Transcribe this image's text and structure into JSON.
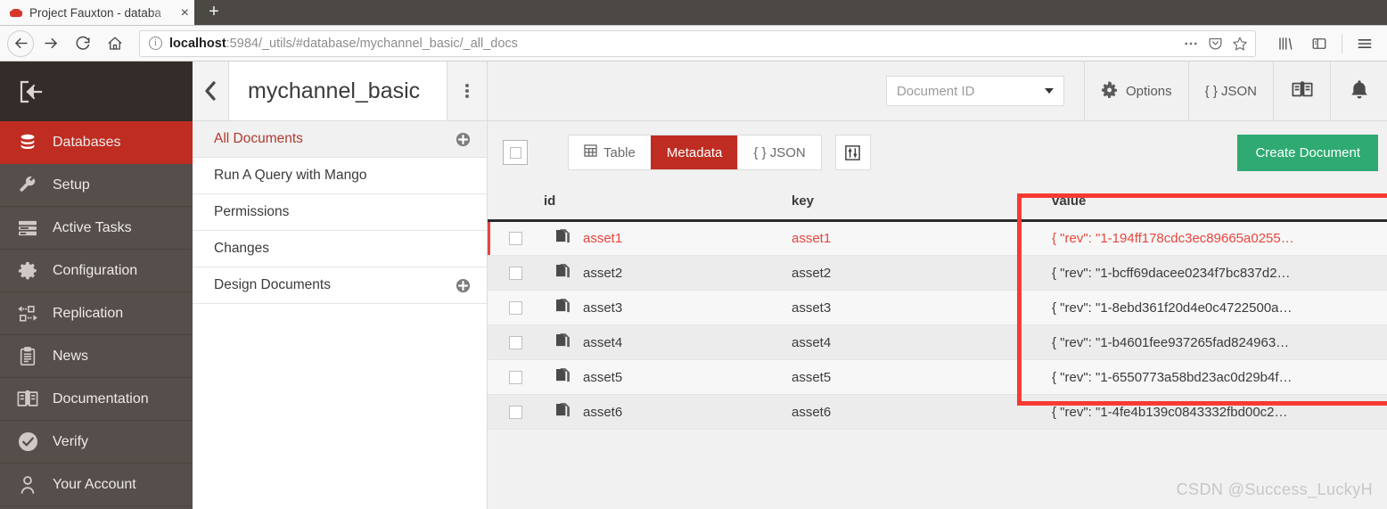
{
  "browser": {
    "tab": {
      "title": "Project Fauxton - databa",
      "favicon": "couchdb-icon",
      "close": "×"
    },
    "new_tab_label": "+",
    "nav": {
      "back": "back-arrow-icon",
      "forward": "forward-arrow-icon",
      "reload": "reload-icon",
      "home": "home-icon"
    },
    "url": {
      "host": "localhost",
      "rest": ":5984/_utils/#database/mychannel_basic/_all_docs",
      "info_glyph": "ⓘ"
    },
    "url_actions": [
      "page-actions-ellipsis-icon",
      "pocket-icon",
      "bookmark-star-icon"
    ],
    "toolbar_right": [
      "library-icon",
      "sidebar-icon",
      "hamburger-menu-icon"
    ]
  },
  "sidebar": {
    "logo": "fauxton-logo-icon",
    "items": [
      {
        "label": "Databases",
        "icon": "database-icon",
        "active": true
      },
      {
        "label": "Setup",
        "icon": "wrench-icon",
        "active": false
      },
      {
        "label": "Active Tasks",
        "icon": "tasks-icon",
        "active": false
      },
      {
        "label": "Configuration",
        "icon": "gear-icon",
        "active": false
      },
      {
        "label": "Replication",
        "icon": "replication-icon",
        "active": false
      },
      {
        "label": "News",
        "icon": "clipboard-icon",
        "active": false
      },
      {
        "label": "Documentation",
        "icon": "book-icon",
        "active": false
      },
      {
        "label": "Verify",
        "icon": "check-circle-icon",
        "active": false
      },
      {
        "label": "Your Account",
        "icon": "user-icon",
        "active": false
      }
    ]
  },
  "panel": {
    "back_icon": "chevron-left-icon",
    "database_name": "mychannel_basic",
    "kebab_icon": "vertical-dots-icon",
    "items": [
      {
        "label": "All Documents",
        "active": true,
        "plus": true
      },
      {
        "label": "Run A Query with Mango",
        "active": false,
        "plus": false
      },
      {
        "label": "Permissions",
        "active": false,
        "plus": false
      },
      {
        "label": "Changes",
        "active": false,
        "plus": false
      },
      {
        "label": "Design Documents",
        "active": false,
        "plus": true
      }
    ]
  },
  "header": {
    "document_id_placeholder": "Document ID",
    "options_label": "Options",
    "json_label": "{ } JSON",
    "docs_icon": "book-icon",
    "notifications_icon": "bell-icon"
  },
  "toolbar": {
    "select_all_label": "select-all-checkbox",
    "views": [
      {
        "label": "Table",
        "icon": "table-icon",
        "active": false
      },
      {
        "label": "Metadata",
        "icon": "",
        "active": true
      },
      {
        "label": "{ } JSON",
        "icon": "",
        "active": false
      }
    ],
    "filter_icon": "sliders-icon",
    "create_document_label": "Create Document"
  },
  "table": {
    "columns": [
      "id",
      "key",
      "value"
    ],
    "rows": [
      {
        "id": "asset1",
        "key": "asset1",
        "value": "{ \"rev\": \"1-194ff178cdc3ec89665a0255…",
        "selected": true
      },
      {
        "id": "asset2",
        "key": "asset2",
        "value": "{ \"rev\": \"1-bcff69dacee0234f7bc837d2…",
        "selected": false
      },
      {
        "id": "asset3",
        "key": "asset3",
        "value": "{ \"rev\": \"1-8ebd361f20d4e0c4722500a…",
        "selected": false
      },
      {
        "id": "asset4",
        "key": "asset4",
        "value": "{ \"rev\": \"1-b4601fee937265fad824963…",
        "selected": false
      },
      {
        "id": "asset5",
        "key": "asset5",
        "value": "{ \"rev\": \"1-6550773a58bd23ac0d29b4f…",
        "selected": false
      },
      {
        "id": "asset6",
        "key": "asset6",
        "value": "{ \"rev\": \"1-4fe4b139c0843332fbd00c2…",
        "selected": false
      }
    ]
  },
  "watermark": "CSDN @Success_LuckyH",
  "colors": {
    "accent_red": "#bf2d22",
    "sidebar_bg": "#564e4a",
    "logo_bg": "#332c2a",
    "green": "#2eaa72",
    "annotation_red": "#f93b33"
  }
}
